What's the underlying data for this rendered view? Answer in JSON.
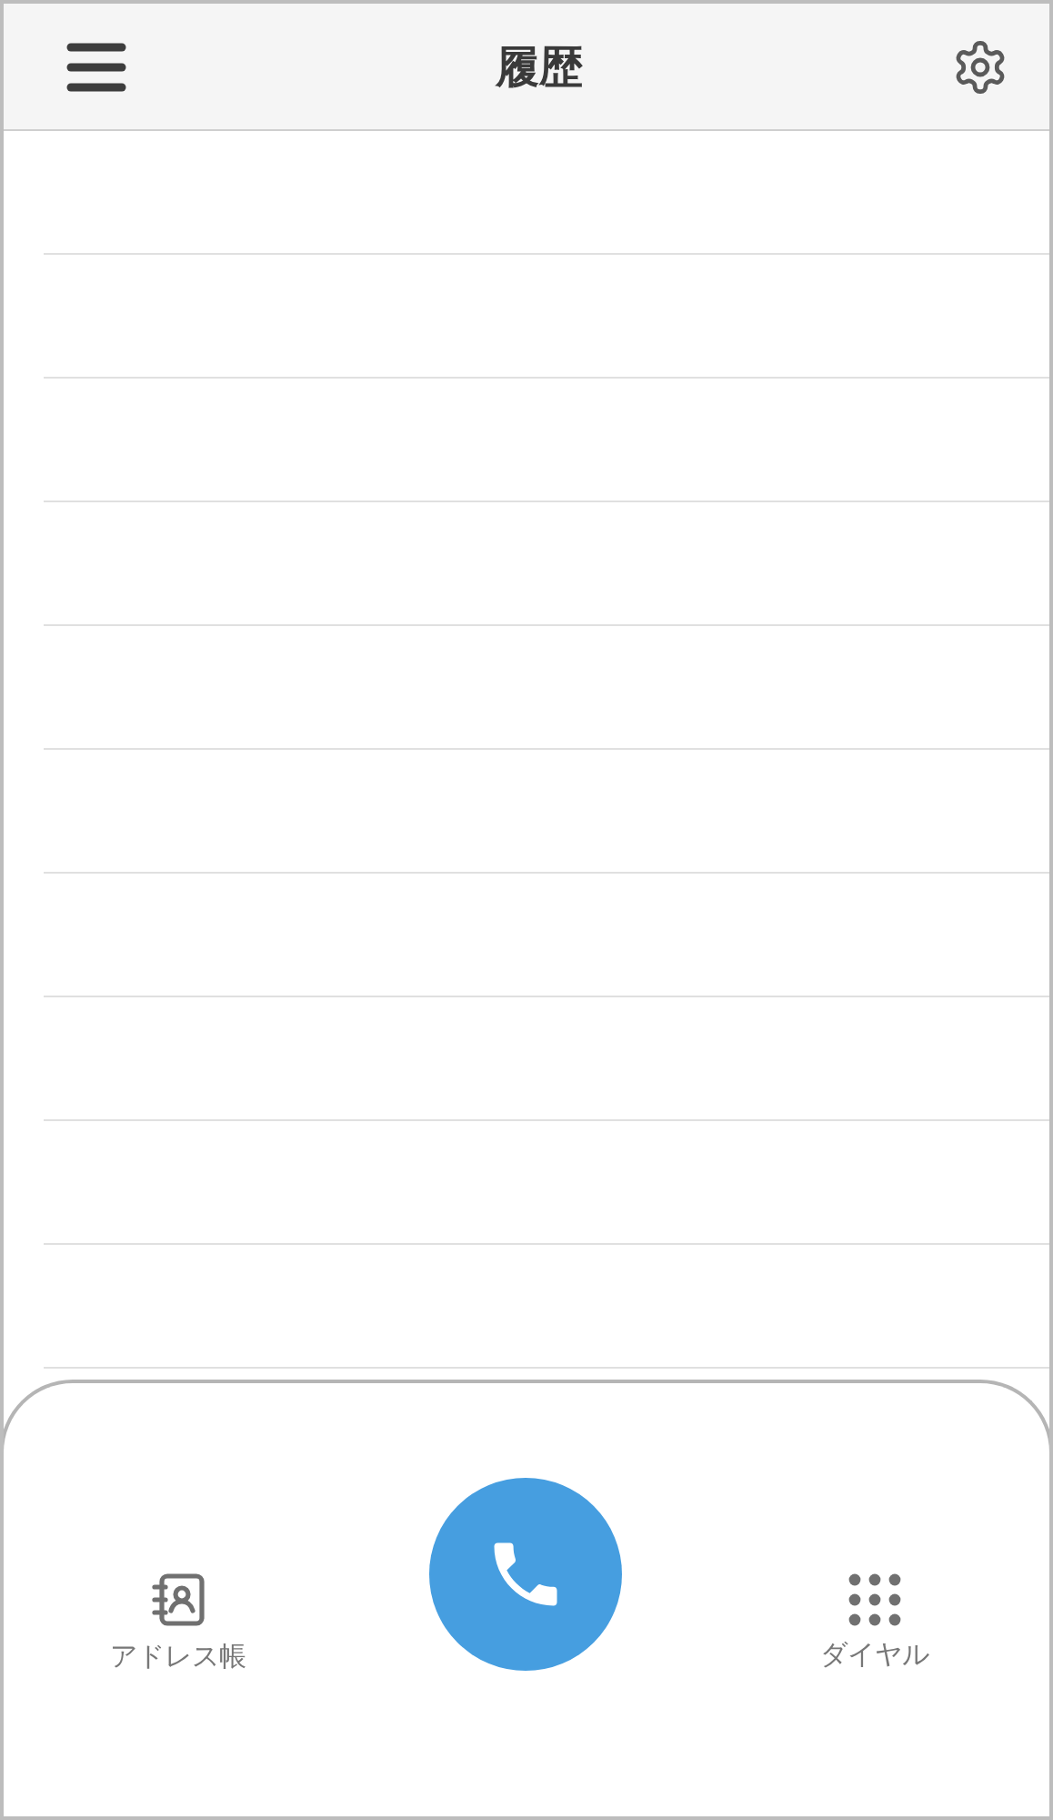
{
  "header": {
    "title": "履歴"
  },
  "bottom_bar": {
    "items": [
      {
        "kind": "contacts",
        "label": "アドレス帳"
      },
      {
        "kind": "call"
      },
      {
        "kind": "dial",
        "label": "ダイヤル"
      }
    ]
  }
}
